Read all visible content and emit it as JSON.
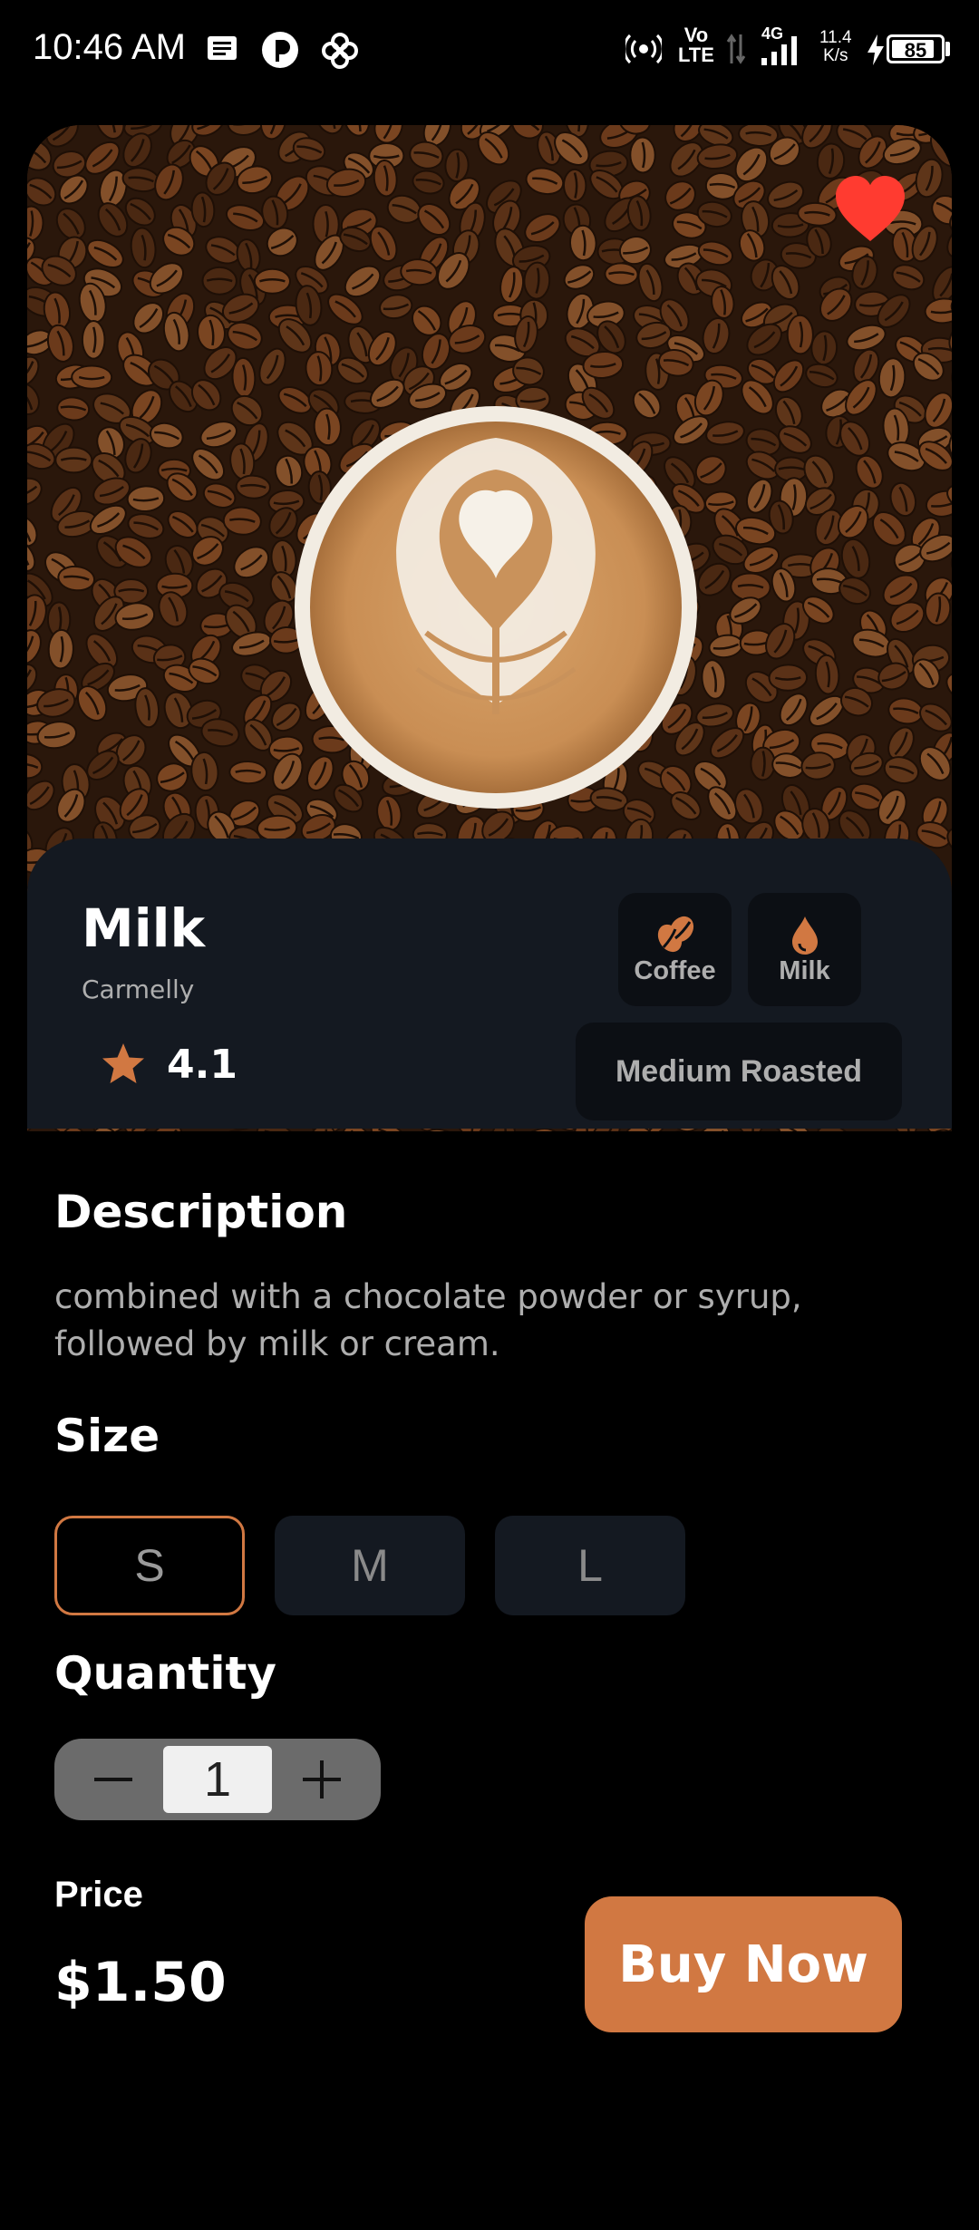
{
  "status_bar": {
    "time": "10:46 AM",
    "network": "4G",
    "volte_top": "Vo",
    "volte_bottom": "LTE",
    "speed_top": "11.4",
    "speed_bottom": "K/s",
    "battery": "85",
    "icons": [
      "message-icon",
      "app-icon",
      "fan-icon",
      "hotspot-icon",
      "signal-icon",
      "charging-icon",
      "battery-icon"
    ]
  },
  "product": {
    "name": "Milk",
    "subtitle": "Carmelly",
    "rating": "4.1",
    "favorite": true,
    "tags": [
      {
        "label": "Coffee",
        "icon": "coffee-bean-icon"
      },
      {
        "label": "Milk",
        "icon": "drop-icon"
      }
    ],
    "roast": "Medium Roasted"
  },
  "description": {
    "title": "Description",
    "text": "combined with a chocolate powder or syrup, followed by milk or cream."
  },
  "size": {
    "title": "Size",
    "options": [
      "S",
      "M",
      "L"
    ],
    "selected": "S"
  },
  "quantity": {
    "title": "Quantity",
    "value": "1"
  },
  "price": {
    "label": "Price",
    "value": "$1.50"
  },
  "actions": {
    "buy_label": "Buy Now"
  },
  "colors": {
    "accent": "#d17842",
    "heart": "#ff3b30",
    "panel": "#141921",
    "chip": "#0c0f14"
  }
}
